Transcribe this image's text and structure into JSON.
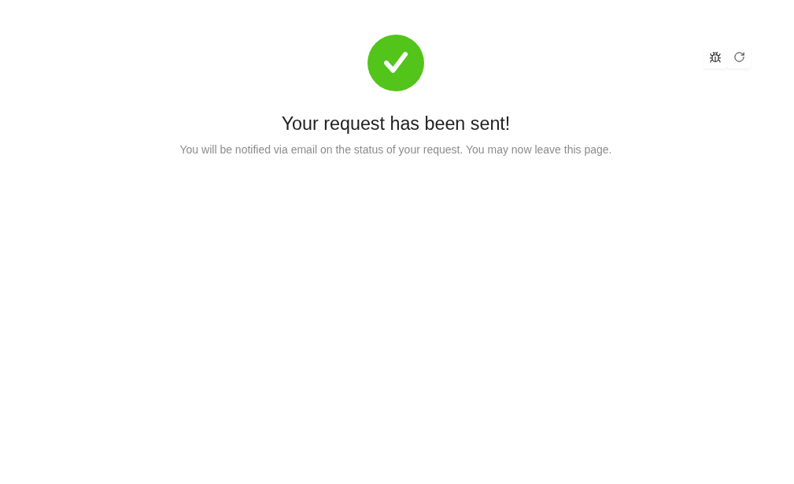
{
  "result": {
    "title": "Your request has been sent!",
    "subtitle": "You will be notified via email on the status of your request. You may now leave this page."
  }
}
